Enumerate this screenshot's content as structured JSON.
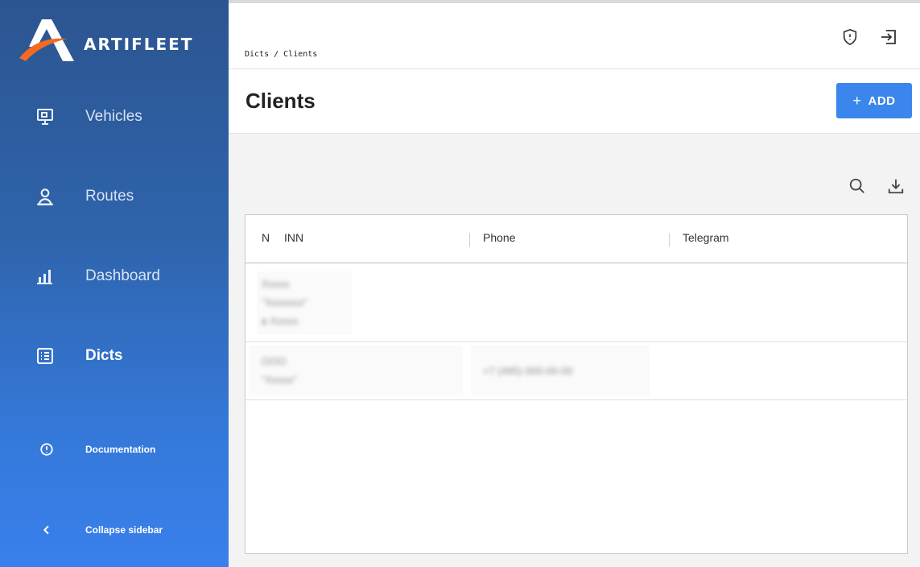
{
  "sidebar": {
    "brand": "ARTIFLEET",
    "items": [
      {
        "label": "Vehicles",
        "icon": "monitor-icon"
      },
      {
        "label": "Routes",
        "icon": "user-pin-icon"
      },
      {
        "label": "Dashboard",
        "icon": "bar-chart-icon"
      },
      {
        "label": "Dicts",
        "icon": "list-icon",
        "active": true
      }
    ],
    "footer": [
      {
        "label": "Documentation",
        "icon": "info-circle-icon"
      },
      {
        "label": "Collapse sidebar",
        "icon": "chevron-left-icon"
      }
    ]
  },
  "header": {
    "breadcrumb": "Dicts / Clients",
    "icons": [
      "shield-icon",
      "logout-icon"
    ]
  },
  "page": {
    "title": "Clients",
    "add_label": "ADD",
    "add_icon": "plus-icon"
  },
  "toolbar": {
    "icons": [
      "search-icon",
      "download-icon"
    ]
  },
  "table": {
    "columns": [
      "N",
      "INN",
      "Phone",
      "Telegram"
    ],
    "rows": [
      {
        "n": [
          "Ххххх",
          "\"Ххххххх\"",
          "в Ххххх"
        ],
        "phone": "",
        "telegram": ""
      },
      {
        "n": [
          "ООО",
          "\"Ххххх\""
        ],
        "phone": "+7 (495) 000-00-00",
        "telegram": ""
      }
    ]
  },
  "colors": {
    "accent": "#3a86ec",
    "sidebar_top": "#2b5590",
    "sidebar_bottom": "#3a80ec",
    "logo_orange": "#f26b21"
  }
}
